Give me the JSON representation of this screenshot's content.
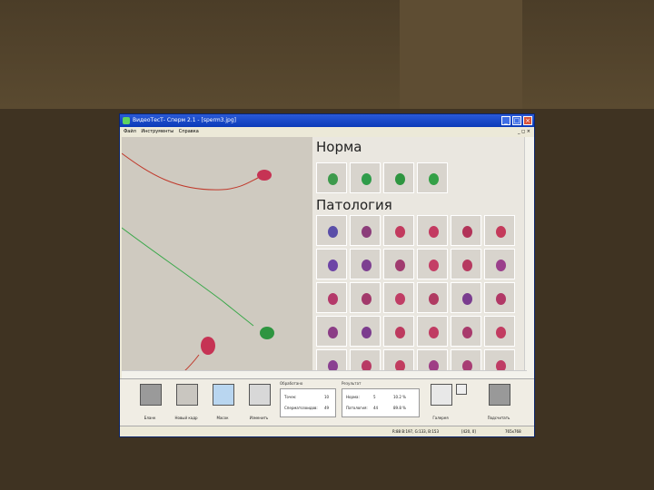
{
  "window": {
    "title": "ВидеоТесТ- Сперм 2.1 - [sperm3.jpg]",
    "menu": [
      "Файл",
      "Инструменты",
      "Справка"
    ],
    "menu_right": "_ ◻ ×"
  },
  "gallery": {
    "norm_title": "Норма",
    "pathology_title": "Патология",
    "norm_colors": [
      "#3d9a4c",
      "#2f9c4a",
      "#2e9540",
      "#34a047"
    ],
    "pathology_colors": [
      "#5a4ea8",
      "#8c3d7a",
      "#c23a5e",
      "#c33a61",
      "#b23358",
      "#c43a5b",
      "#6d44a6",
      "#7d3f91",
      "#a03b6f",
      "#c43e66",
      "#b63a60",
      "#9b3f8c",
      "#b4396a",
      "#a2396b",
      "#c03d65",
      "#b03b62",
      "#7a3c8f",
      "#b13866",
      "#8b3d86",
      "#7c3c8e",
      "#bd3a5f",
      "#c03c63",
      "#a83a6c",
      "#c23c61",
      "#8a4091",
      "#b83a64",
      "#c13c5f",
      "#9e3d85",
      "#a83d74",
      "#bf3c65"
    ]
  },
  "toolbar": {
    "buttons": [
      "Бланк",
      "Новый кадр",
      "Масок",
      "Изменить"
    ],
    "processed_label": "Обработано",
    "counted_label": "Точек:",
    "counted_value": "10",
    "sperm_label": "Сперматозоидов:",
    "sperm_value": "49",
    "results_label": "Результат",
    "norm_label": "Норма:",
    "norm_count": "5",
    "norm_pct": "10.2 %",
    "path_label": "Патология:",
    "path_count": "44",
    "path_pct": "89.8 %",
    "gallery_label": "Галерея",
    "count_label": "Подсчитать"
  },
  "statusbar": {
    "rgb": "R:88 B:197, G:133, B:153",
    "coords": "[420, 0]",
    "size": "765x768"
  }
}
